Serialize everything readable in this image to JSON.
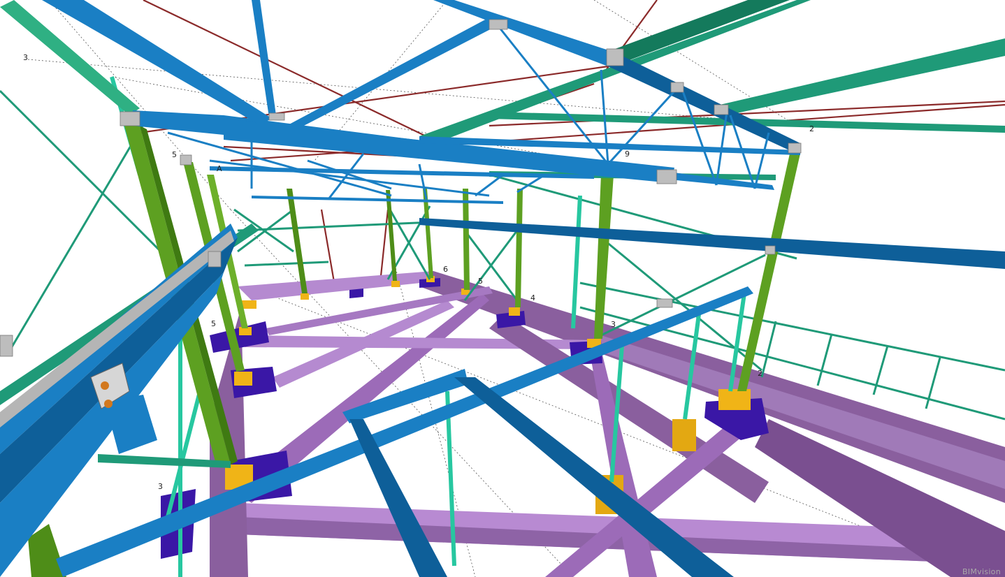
{
  "scene": {
    "description_type": "3D steel-frame model render",
    "grid_labels": [
      "3",
      "5",
      "A",
      "2",
      "6",
      "5",
      "4",
      "3",
      "2",
      "5",
      "3",
      "9"
    ],
    "watermark": "BIMvision"
  },
  "colors": {
    "background": "#ffffff",
    "rafter_blue": "#1a7fc4",
    "rafter_blue_dark": "#0e5f99",
    "purlin_green": "#1f9a78",
    "purlin_green_dark": "#147a5c",
    "column_green": "#5da021",
    "column_green_dark": "#3f7a12",
    "bracing_red": "#8b2a2a",
    "foundation_purple": "#9b6ab8",
    "foundation_purple_dark": "#6e4a86",
    "pad_indigo": "#3a17a6",
    "baseplate_yellow": "#f0b417",
    "teal_member": "#27c7a0",
    "grid_line": "#555555"
  }
}
